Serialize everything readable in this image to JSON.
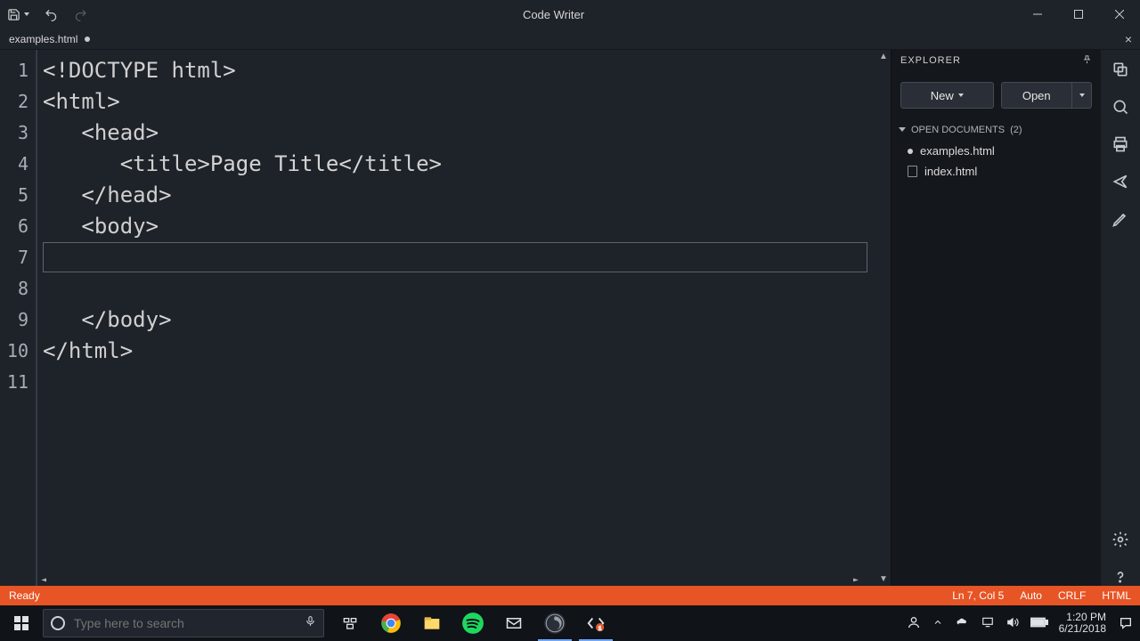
{
  "window": {
    "title": "Code Writer"
  },
  "tab": {
    "name": "examples.html",
    "dirty": true
  },
  "editor": {
    "lines": [
      "<!DOCTYPE html>",
      "<html>",
      "   <head>",
      "      <title>Page Title</title>",
      "   </head>",
      "   <body>",
      "",
      "",
      "   </body>",
      "</html>",
      ""
    ],
    "current_line": 7
  },
  "explorer": {
    "title": "EXPLORER",
    "buttons": {
      "new": "New",
      "open": "Open"
    },
    "section": {
      "label": "OPEN DOCUMENTS",
      "count": "(2)"
    },
    "docs": [
      {
        "name": "examples.html",
        "dirty": true
      },
      {
        "name": "index.html",
        "dirty": false
      }
    ]
  },
  "status": {
    "left": "Ready",
    "position": "Ln 7, Col 5",
    "encoding_mode": "Auto",
    "eol": "CRLF",
    "language": "HTML"
  },
  "taskbar": {
    "search_placeholder": "Type here to search",
    "clock": {
      "time": "1:20 PM",
      "date": "6/21/2018"
    }
  }
}
